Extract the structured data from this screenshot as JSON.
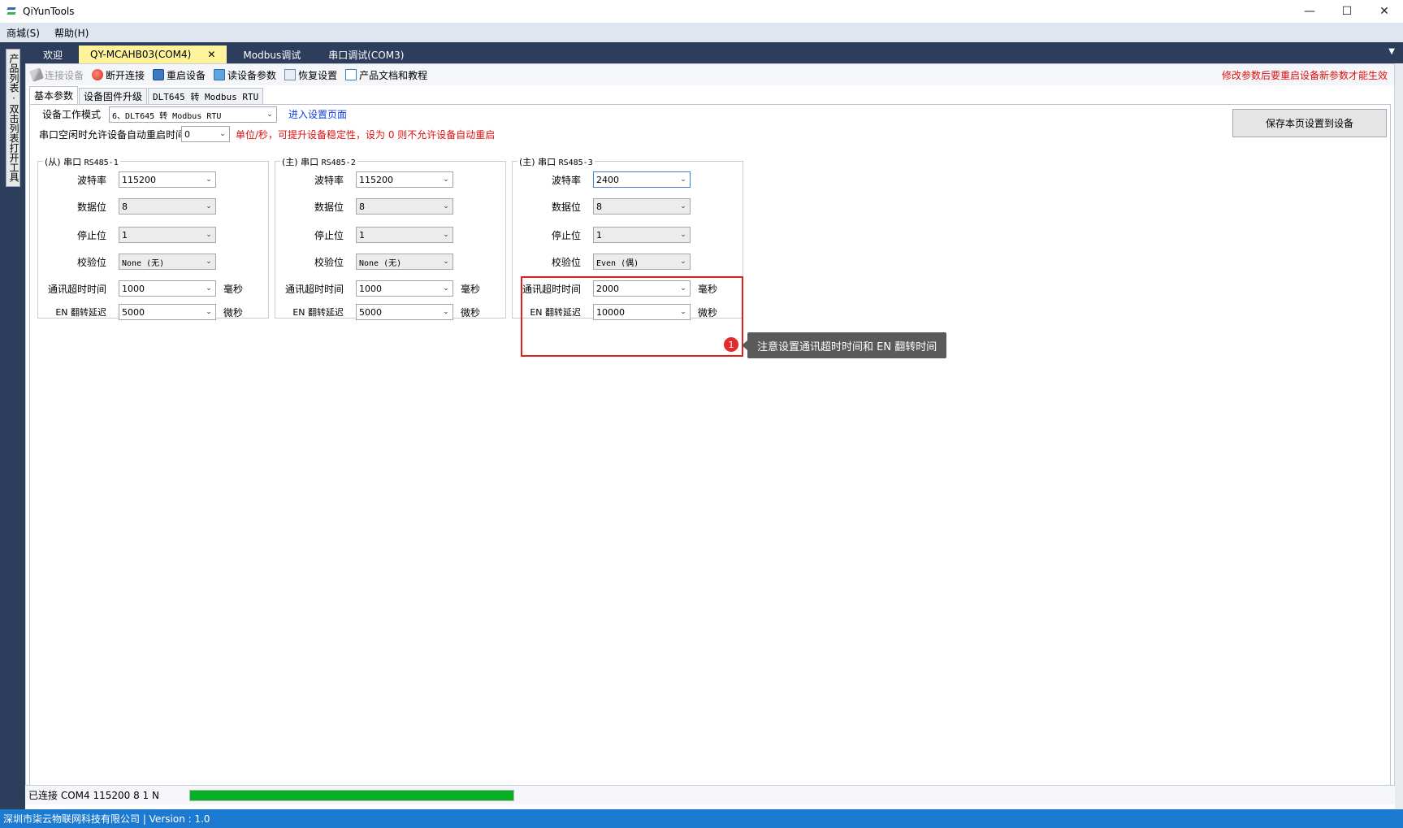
{
  "window": {
    "title": "QiYunTools",
    "minimize": "—",
    "maximize": "☐",
    "close": "✕"
  },
  "menu": [
    {
      "label": "商城(S)"
    },
    {
      "label": "帮助(H)"
    }
  ],
  "sidebar": {
    "tab_label": "产品列表·双击列表打开工具"
  },
  "doc_tabs": [
    {
      "label": "欢迎"
    },
    {
      "label": "QY-MCAHB03(COM4)",
      "close": "✕"
    },
    {
      "label": "Modbus调试"
    },
    {
      "label": "串口调试(COM3)"
    }
  ],
  "tabs_dropdown": "▼",
  "toolbar": {
    "connect": "连接设备",
    "disconnect": "断开连接",
    "restart": "重启设备",
    "read_params": "读设备参数",
    "restore": "恢复设置",
    "docs": "产品文档和教程",
    "warning": "修改参数后要重启设备新参数才能生效"
  },
  "sub_tabs": [
    {
      "label": "基本参数"
    },
    {
      "label": "设备固件升级"
    },
    {
      "label": "DLT645 转 Modbus RTU"
    }
  ],
  "settings": {
    "mode_label": "设备工作模式",
    "mode_value": "6、DLT645 转 Modbus RTU",
    "enter_settings_link": "进入设置页面",
    "idle_restart_label": "串口空闲时允许设备自动重启时间",
    "idle_restart_value": "0",
    "idle_restart_hint": "单位/秒，可提升设备稳定性，设为 0 则不允许设备自动重启",
    "save_button": "保存本页设置到设备"
  },
  "field_labels": {
    "baud": "波特率",
    "data_bits": "数据位",
    "stop_bits": "停止位",
    "parity": "校验位",
    "timeout": "通讯超时时间",
    "en_delay": "EN 翻转延迟",
    "ms": "毫秒",
    "us": "微秒"
  },
  "groups": [
    {
      "title_prefix": "(从) 串口 ",
      "title_port": "RS485-1",
      "baud": "115200",
      "data_bits": "8",
      "stop_bits": "1",
      "parity": "None (无)",
      "timeout": "1000",
      "en_delay": "5000"
    },
    {
      "title_prefix": "(主) 串口 ",
      "title_port": "RS485-2",
      "baud": "115200",
      "data_bits": "8",
      "stop_bits": "1",
      "parity": "None (无)",
      "timeout": "1000",
      "en_delay": "5000"
    },
    {
      "title_prefix": "(主) 串口 ",
      "title_port": "RS485-3",
      "baud": "2400",
      "data_bits": "8",
      "stop_bits": "1",
      "parity": "Even (偶)",
      "timeout": "2000",
      "en_delay": "10000"
    }
  ],
  "callout": {
    "number": "1",
    "text": "注意设置通讯超时时间和 EN 翻转时间",
    "color": "#e02020"
  },
  "status": {
    "text": "已连接 COM4 115200 8 1 N",
    "progress": 1.0,
    "progress_color": "#06b025"
  },
  "footer": {
    "text": "深圳市柒云物联网科技有限公司 | Version : 1.0"
  }
}
